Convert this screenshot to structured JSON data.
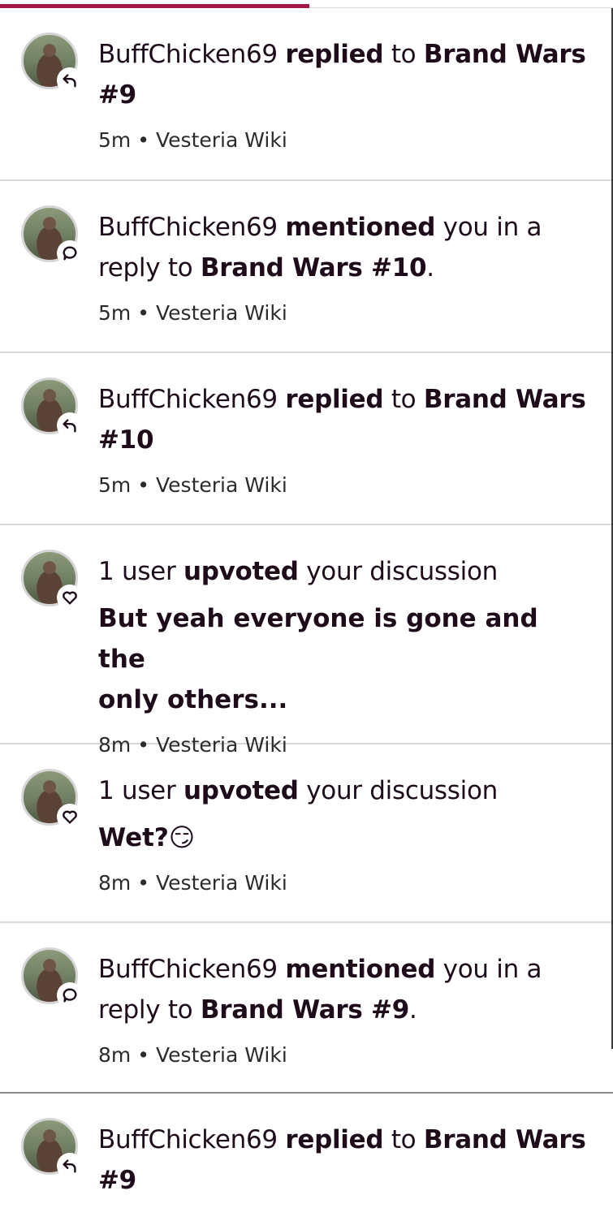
{
  "progress": {
    "fraction": 0.505
  },
  "notifications": [
    {
      "actor": "BuffChicken69",
      "action": "replied",
      "connector": "to",
      "target": "Brand Wars #9",
      "line1_target_part": "Brand Wars",
      "line2_target_part": "#9",
      "time": "5m",
      "wiki": "Vesteria Wiki",
      "icon": "reply-icon"
    },
    {
      "actor": "BuffChicken69",
      "action": "mentioned",
      "middle": "you in a",
      "line2_prefix": "reply to",
      "target": "Brand Wars #10",
      "line2_suffix": ".",
      "time": "5m",
      "wiki": "Vesteria Wiki",
      "icon": "comment-icon"
    },
    {
      "actor": "BuffChicken69",
      "action": "replied",
      "connector": "to",
      "line1_target_part": "Brand Wars",
      "line2_target_part": "#10",
      "time": "5m",
      "wiki": "Vesteria Wiki",
      "icon": "reply-icon"
    },
    {
      "count_text": "1 user",
      "action": "upvoted",
      "object": "your discussion",
      "subject_line1": "But yeah everyone is gone and the",
      "subject_line2": "only others...",
      "time": "8m",
      "wiki": "Vesteria Wiki",
      "icon": "heart-icon"
    },
    {
      "count_text": "1 user",
      "action": "upvoted",
      "object": "your discussion",
      "subject_line1": "Wet?😏",
      "time": "8m",
      "wiki": "Vesteria Wiki",
      "icon": "heart-icon"
    },
    {
      "actor": "BuffChicken69",
      "action": "mentioned",
      "middle": "you in a",
      "line2_prefix": "reply to",
      "target": "Brand Wars #9",
      "line2_suffix": ".",
      "time": "8m",
      "wiki": "Vesteria Wiki",
      "icon": "comment-icon"
    }
  ],
  "extra_notification": {
    "actor": "BuffChicken69",
    "action": "replied",
    "connector": "to",
    "line1_target_part": "Brand Wars",
    "line2_target_part": "#9",
    "icon": "reply-icon"
  }
}
